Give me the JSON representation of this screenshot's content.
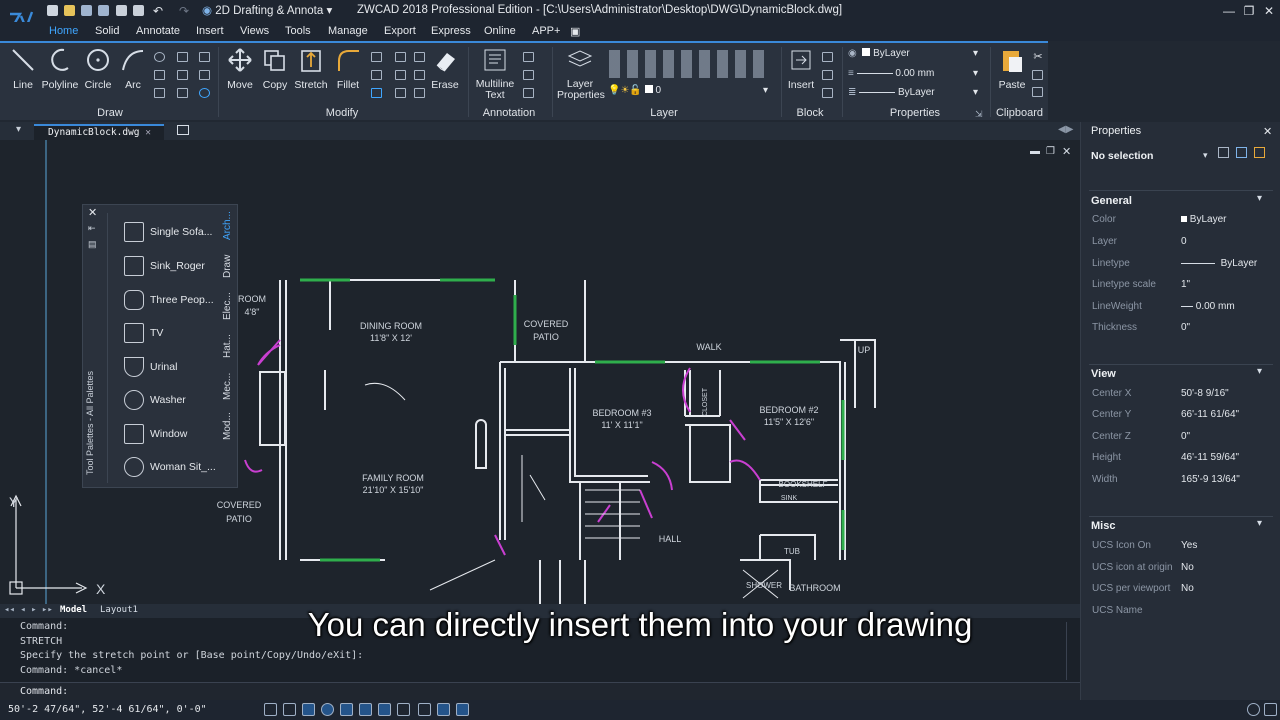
{
  "app": {
    "title": "ZWCAD 2018 Professional Edition - [C:\\Users\\Administrator\\Desktop\\DWG\\DynamicBlock.dwg]",
    "workspace": "2D Drafting & Annota"
  },
  "menus": [
    "Home",
    "Solid",
    "Annotate",
    "Insert",
    "Views",
    "Tools",
    "Manage",
    "Export",
    "Express",
    "Online",
    "APP+"
  ],
  "ribbon": {
    "draw": [
      "Line",
      "Polyline",
      "Circle",
      "Arc"
    ],
    "modify": [
      "Move",
      "Copy",
      "Stretch",
      "Fillet",
      "Erase"
    ],
    "annotation_btn": "Multiline\nText",
    "layer_btn": "Layer\nProperties",
    "layer_value": "0",
    "insert_btn": "Insert",
    "paste_btn": "Paste",
    "prop_color": "ByLayer",
    "prop_lineweight": "0.00 mm",
    "prop_linetype": "ByLayer",
    "groups": [
      "Draw",
      "Modify",
      "Annotation",
      "Layer",
      "Block",
      "Properties",
      "Clipboard"
    ]
  },
  "doc_tab": "DynamicBlock.dwg",
  "palette": {
    "title": "Tool Palettes - All Palettes",
    "items": [
      "Single Sofa...",
      "Sink_Roger",
      "Three Peop...",
      "TV",
      "Urinal",
      "Washer",
      "Window",
      "Woman Sit_..."
    ],
    "tabs": [
      "Arch...",
      "Draw",
      "Elec...",
      "Hat...",
      "Mec...",
      "Mod..."
    ]
  },
  "drawing_labels": {
    "dining": "DINING ROOM",
    "dining_size": "11'8\" X 12'",
    "covered": "COVERED",
    "patio": "PATIO",
    "walk": "WALK",
    "up": "UP",
    "bed3": "BEDROOM #3",
    "bed3_size": "11' X 11'1\"",
    "bed2": "BEDROOM #2",
    "bed2_size": "11'5\" X 12'6\"",
    "family": "FAMILY ROOM",
    "family_size": "21'10\" X 15'10\"",
    "covered2": "COVERED",
    "patio2": "PATIO",
    "closet": "CLOSET",
    "bookshelf": "BOOKSHELF",
    "sink": "SINK",
    "tub": "TUB",
    "shower": "SHOWER",
    "bath": "BATHROOM",
    "hall": "HALL",
    "room": "ROOM",
    "room_size": "4'8\""
  },
  "layout_tabs": [
    "Model",
    "Layout1"
  ],
  "command_lines": [
    "Command:",
    "STRETCH",
    "Specify the stretch point or [Base point/Copy/Undo/eXit]:",
    "Command: *cancel*"
  ],
  "command_prompt": "Command:",
  "coords": "50'-2 47/64\", 52'-4 61/64\", 0'-0\"",
  "properties": {
    "title": "Properties",
    "selection": "No selection",
    "general": "General",
    "general_rows": [
      [
        "Color",
        "ByLayer"
      ],
      [
        "Layer",
        "0"
      ],
      [
        "Linetype",
        "ByLayer"
      ],
      [
        "Linetype scale",
        "1\""
      ],
      [
        "LineWeight",
        "0.00 mm"
      ],
      [
        "Thickness",
        "0\""
      ]
    ],
    "view": "View",
    "view_rows": [
      [
        "Center X",
        "50'-8 9/16\""
      ],
      [
        "Center Y",
        "66'-11 61/64\""
      ],
      [
        "Center Z",
        "0\""
      ],
      [
        "Height",
        "46'-11 59/64\""
      ],
      [
        "Width",
        "165'-9 13/64\""
      ]
    ],
    "misc": "Misc",
    "misc_rows": [
      [
        "UCS Icon On",
        "Yes"
      ],
      [
        "UCS icon at origin",
        "No"
      ],
      [
        "UCS per viewport",
        "No"
      ],
      [
        "UCS Name",
        ""
      ]
    ]
  },
  "subtitle": "You can directly insert them into your drawing",
  "colors": {
    "accent": "#3a89d9",
    "wall": "#ffffff",
    "door": "#c93fd1",
    "window": "#2fae4c"
  }
}
